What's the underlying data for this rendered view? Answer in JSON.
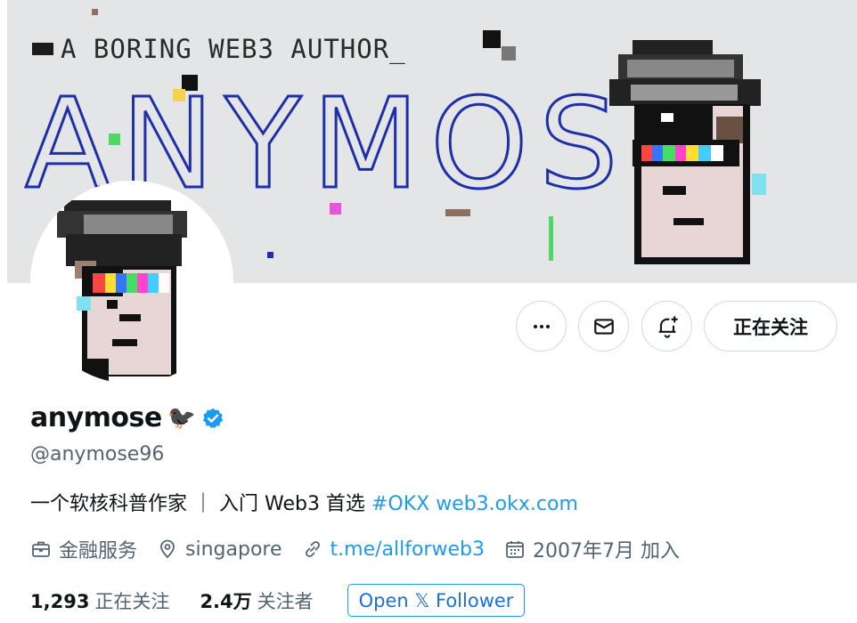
{
  "banner": {
    "tagline": "A BORING WEB3 AUTHOR_",
    "big_text": "ANYMOSE"
  },
  "actions": {
    "more_icon": "more-horizontal-icon",
    "message_icon": "mail-icon",
    "notify_icon": "bell-plus-icon",
    "following_label": "正在关注"
  },
  "profile": {
    "display_name": "anymose",
    "name_emoji": "🐦‍⬛",
    "verified": true,
    "handle": "@anymose96",
    "bio_text": "一个软核科普作家 ｜ 入门 Web3 首选",
    "bio_hashtag": "#OKX",
    "bio_link": "web3.okx.com",
    "category": "金融服务",
    "location": "singapore",
    "website": "t.me/allforweb3",
    "joined": "2007年7月 加入"
  },
  "stats": {
    "following_count": "1,293",
    "following_label": "正在关注",
    "followers_count": "2.4万",
    "followers_label": "关注者",
    "open_follower_label": "Open 𝕏 Follower"
  },
  "colors": {
    "accent": "#1d9bf0",
    "verified": "#1d9bf0",
    "banner_bg": "#e3e5e6",
    "banner_text_stroke": "#1e2fa8"
  }
}
